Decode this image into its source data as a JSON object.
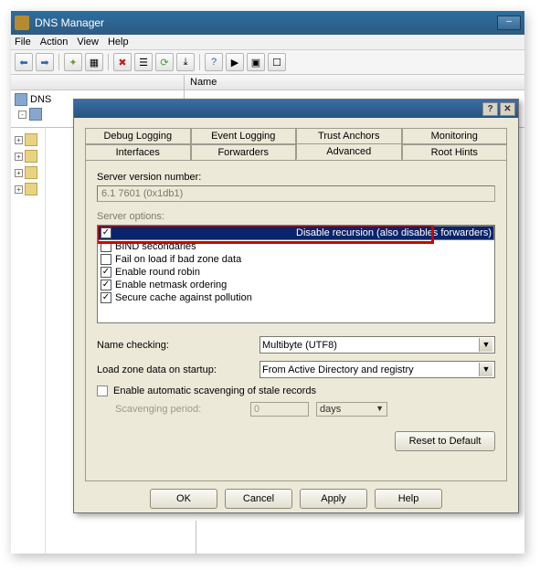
{
  "window": {
    "title": "DNS Manager"
  },
  "menu": {
    "file": "File",
    "action": "Action",
    "view": "View",
    "help": "Help"
  },
  "tree": {
    "root": "DNS",
    "name_col": "Name"
  },
  "dialog": {
    "tabs": {
      "debug_logging": "Debug Logging",
      "event_logging": "Event Logging",
      "trust_anchors": "Trust Anchors",
      "monitoring": "Monitoring",
      "interfaces": "Interfaces",
      "forwarders": "Forwarders",
      "advanced": "Advanced",
      "root_hints": "Root Hints"
    },
    "server_version_label": "Server version number:",
    "server_version_value": "6.1 7601 (0x1db1)",
    "server_options_label": "Server options:",
    "options": {
      "disable_recursion": "Disable recursion (also disables forwarders)",
      "bind_secondaries": "BIND secondaries",
      "fail_on_load": "Fail on load if bad zone data",
      "round_robin": "Enable round robin",
      "netmask": "Enable netmask ordering",
      "secure_cache": "Secure cache against pollution"
    },
    "option_state": {
      "disable_recursion": true,
      "bind_secondaries": false,
      "fail_on_load": false,
      "round_robin": true,
      "netmask": true,
      "secure_cache": true
    },
    "name_checking_label": "Name checking:",
    "name_checking_value": "Multibyte (UTF8)",
    "load_zone_label": "Load zone data on startup:",
    "load_zone_value": "From Active Directory and registry",
    "scavenging_check": "Enable automatic scavenging of stale records",
    "scavenging_period_label": "Scavenging period:",
    "scavenging_period_value": "0",
    "scavenging_period_unit": "days",
    "reset_btn": "Reset to Default",
    "ok": "OK",
    "cancel": "Cancel",
    "apply": "Apply",
    "help": "Help"
  }
}
